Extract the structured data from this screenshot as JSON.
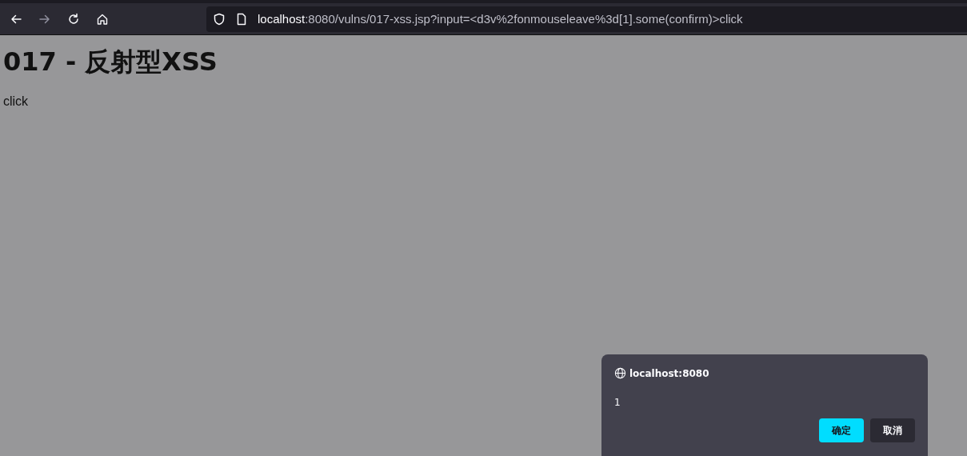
{
  "toolbar": {
    "nav_buttons": [
      {
        "kind": "back",
        "disabled": false
      },
      {
        "kind": "forward",
        "disabled": true
      },
      {
        "kind": "reload",
        "disabled": false
      },
      {
        "kind": "home",
        "disabled": false
      }
    ],
    "url": {
      "host": "localhost",
      "rest": ":8080/vulns/017-xss.jsp?input=<d3v%2fonmouseleave%3d[1].some(confirm)>click"
    }
  },
  "page": {
    "heading": "017 - 反射型XSS",
    "text": "click"
  },
  "dialog": {
    "origin": "localhost:8080",
    "message": "1",
    "buttons": [
      {
        "label": "确定",
        "kind": "primary"
      },
      {
        "label": "取消",
        "kind": "secondary"
      }
    ]
  }
}
